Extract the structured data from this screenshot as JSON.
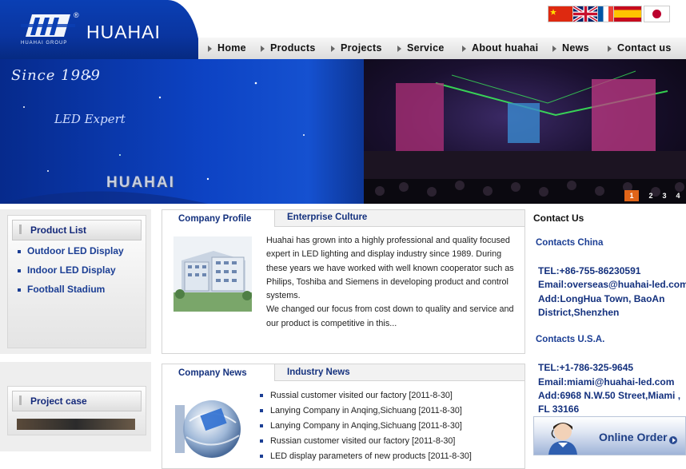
{
  "header": {
    "brand": "HUAHAI",
    "brand_sub": "HUAHAI GROUP",
    "trademark": "®"
  },
  "flags": [
    "china-flag-icon",
    "uk-flag-icon",
    "france-flag-icon",
    "spain-flag-icon",
    "japan-flag-icon"
  ],
  "nav": {
    "items": [
      "Home",
      "Products",
      "Projects",
      "Service",
      "About huahai",
      "News",
      "Contact us"
    ]
  },
  "banner": {
    "since": "Since 1989",
    "tagline": "LED Expert",
    "brand": "HUAHAI",
    "pager": [
      "1",
      "2",
      "3",
      "4"
    ],
    "active_page": "1"
  },
  "sidebar": {
    "product_title": "Product List",
    "products": [
      "Outdoor LED Display",
      "Indoor LED Display",
      "Football Stadium"
    ],
    "case_title": "Project case"
  },
  "profile": {
    "tab_active": "Company Profile",
    "tab_other": "Enterprise Culture",
    "para1": "Huahai has grown into a highly professional and quality focused expert in LED lighting and display industry since 1989. During these years we have worked with well known cooperator such as Philips, Toshiba and Siemens in developing product and control systems.",
    "para2": "We changed our focus from cost down to quality and service and our product is competitive in this..."
  },
  "news": {
    "tab_active": "Company News",
    "tab_other": "Industry News",
    "items": [
      "Russial customer visited our factory [2011-8-30]",
      "Lanying Company in Anqing,Sichuang [2011-8-30]",
      "Lanying Company in Anqing,Sichuang [2011-8-30]",
      "Russian customer visited our factory [2011-8-30]",
      "LED display parameters of new products [2011-8-30]"
    ]
  },
  "contact": {
    "title": "Contact Us",
    "china_head": "Contacts China",
    "china_tel": "TEL:+86-755-86230591",
    "china_email": "Email:overseas@huahai-led.com",
    "china_addr": "Add:LongHua Town, BaoAn District,Shenzhen",
    "usa_head": "Contacts U.S.A.",
    "usa_tel": "TEL:+1-786-325-9645",
    "usa_email": "Email:miami@huahai-led.com",
    "usa_addr": "Add:6968 N.W.50 Street,Miami , FL 33166",
    "online_order": "Online Order"
  },
  "colors": {
    "brand_blue": "#0a3fb4",
    "link_blue": "#1b3e94",
    "active_pager": "#e06418"
  }
}
